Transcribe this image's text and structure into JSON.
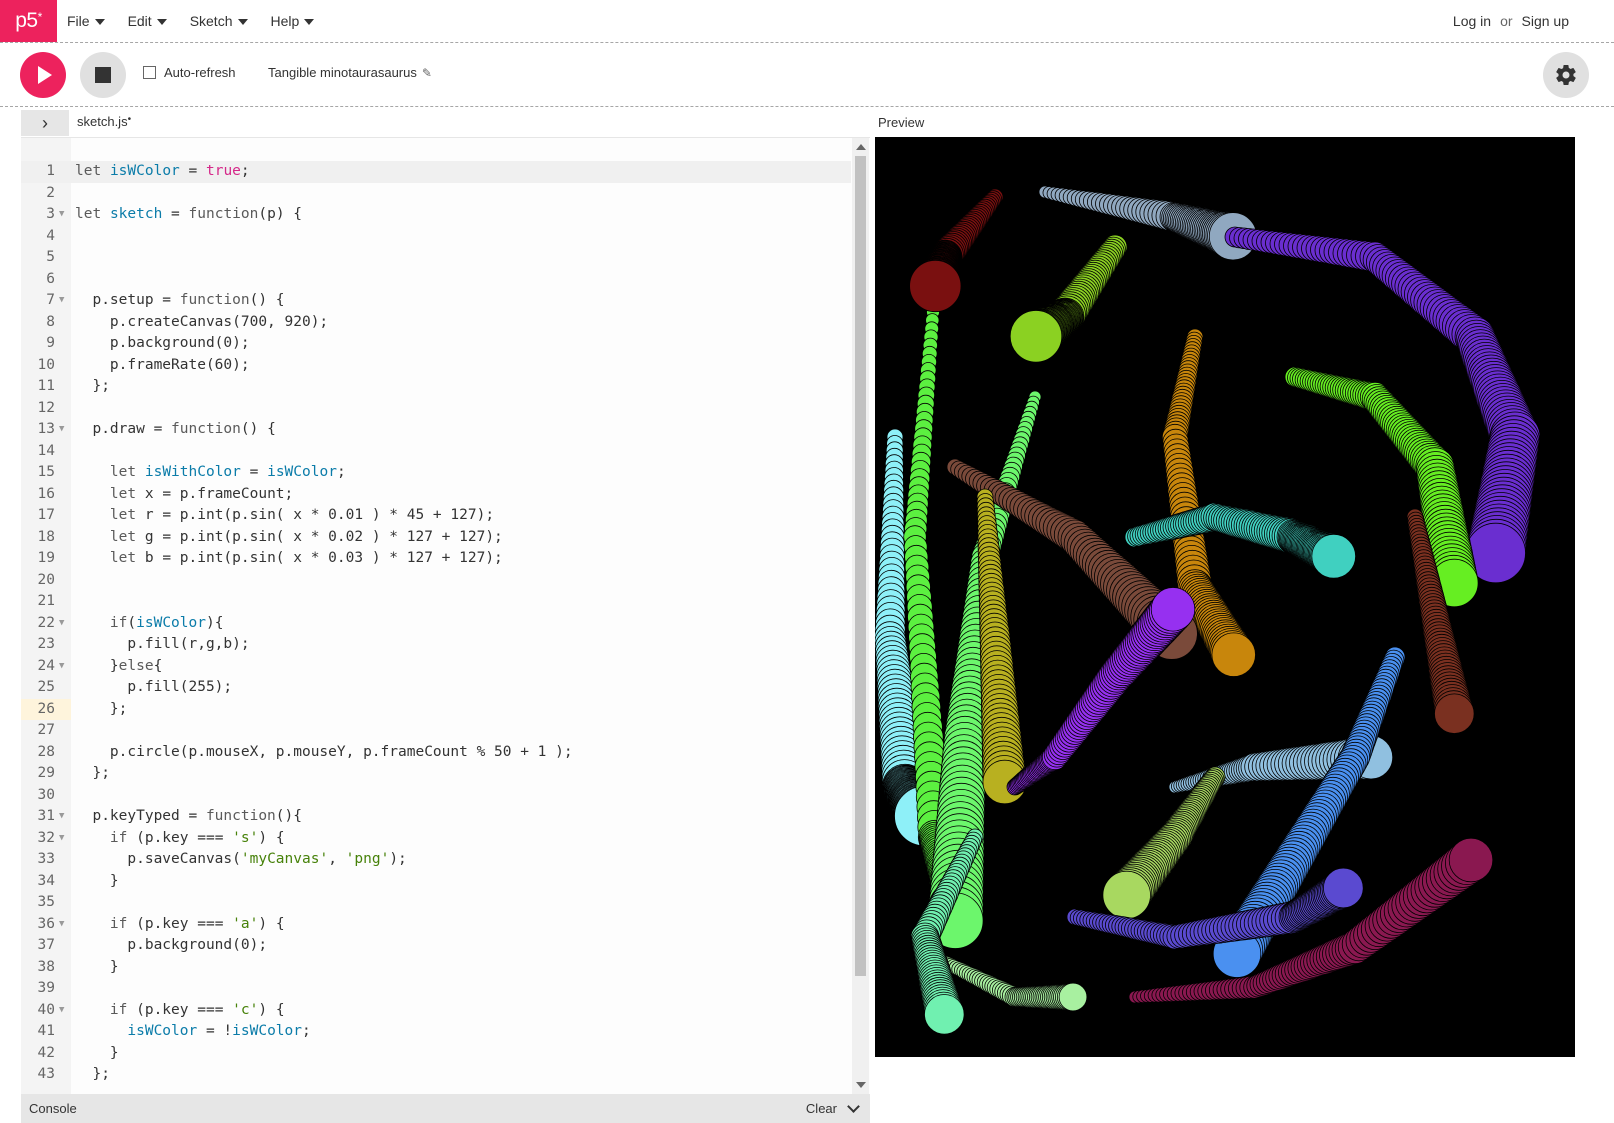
{
  "nav": {
    "logo": "p5",
    "logo_sup": "*",
    "menu": [
      {
        "label": "File"
      },
      {
        "label": "Edit"
      },
      {
        "label": "Sketch"
      },
      {
        "label": "Help"
      }
    ],
    "login": "Log in",
    "or": "or",
    "signup": "Sign up"
  },
  "toolbar": {
    "play_icon": "play-icon",
    "stop_icon": "stop-icon",
    "autorefresh_label": "Auto-refresh",
    "autorefresh_checked": false,
    "sketch_name": "Tangible minotaurasaurus",
    "settings_icon": "gear-icon"
  },
  "editor": {
    "tab_name": "sketch.js",
    "tab_unsaved": "•",
    "current_line": 26,
    "lines": [
      {
        "n": "1",
        "text": "let isWColor = true;",
        "fold": ""
      },
      {
        "n": "2",
        "text": "",
        "fold": ""
      },
      {
        "n": "3",
        "text": "let sketch = function(p) {",
        "fold": "▼"
      },
      {
        "n": "4",
        "text": "",
        "fold": ""
      },
      {
        "n": "5",
        "text": "",
        "fold": ""
      },
      {
        "n": "6",
        "text": "",
        "fold": ""
      },
      {
        "n": "7",
        "text": "  p.setup = function() {",
        "fold": "▼"
      },
      {
        "n": "8",
        "text": "    p.createCanvas(700, 920);",
        "fold": ""
      },
      {
        "n": "9",
        "text": "    p.background(0);",
        "fold": ""
      },
      {
        "n": "10",
        "text": "    p.frameRate(60);",
        "fold": ""
      },
      {
        "n": "11",
        "text": "  };",
        "fold": ""
      },
      {
        "n": "12",
        "text": "",
        "fold": ""
      },
      {
        "n": "13",
        "text": "  p.draw = function() {",
        "fold": "▼"
      },
      {
        "n": "14",
        "text": "",
        "fold": ""
      },
      {
        "n": "15",
        "text": "    let isWithColor = isWColor;",
        "fold": ""
      },
      {
        "n": "16",
        "text": "    let x = p.frameCount;",
        "fold": ""
      },
      {
        "n": "17",
        "text": "    let r = p.int(p.sin( x * 0.01 ) * 45 + 127);",
        "fold": ""
      },
      {
        "n": "18",
        "text": "    let g = p.int(p.sin( x * 0.02 ) * 127 + 127);",
        "fold": ""
      },
      {
        "n": "19",
        "text": "    let b = p.int(p.sin( x * 0.03 ) * 127 + 127);",
        "fold": ""
      },
      {
        "n": "20",
        "text": "",
        "fold": ""
      },
      {
        "n": "21",
        "text": "",
        "fold": ""
      },
      {
        "n": "22",
        "text": "    if(isWColor){",
        "fold": "▼"
      },
      {
        "n": "23",
        "text": "      p.fill(r,g,b);",
        "fold": ""
      },
      {
        "n": "24",
        "text": "    }else{",
        "fold": "▼"
      },
      {
        "n": "25",
        "text": "      p.fill(255);",
        "fold": ""
      },
      {
        "n": "26",
        "text": "    };",
        "fold": ""
      },
      {
        "n": "27",
        "text": "",
        "fold": ""
      },
      {
        "n": "28",
        "text": "    p.circle(p.mouseX, p.mouseY, p.frameCount % 50 + 1 );",
        "fold": ""
      },
      {
        "n": "29",
        "text": "  };",
        "fold": ""
      },
      {
        "n": "30",
        "text": "",
        "fold": ""
      },
      {
        "n": "31",
        "text": "  p.keyTyped = function(){",
        "fold": "▼"
      },
      {
        "n": "32",
        "text": "    if (p.key === 's') {",
        "fold": "▼"
      },
      {
        "n": "33",
        "text": "      p.saveCanvas('myCanvas', 'png');",
        "fold": ""
      },
      {
        "n": "34",
        "text": "    }",
        "fold": ""
      },
      {
        "n": "35",
        "text": "",
        "fold": ""
      },
      {
        "n": "36",
        "text": "    if (p.key === 'a') {",
        "fold": "▼"
      },
      {
        "n": "37",
        "text": "      p.background(0);",
        "fold": ""
      },
      {
        "n": "38",
        "text": "    }",
        "fold": ""
      },
      {
        "n": "39",
        "text": "",
        "fold": ""
      },
      {
        "n": "40",
        "text": "    if (p.key === 'c') {",
        "fold": "▼"
      },
      {
        "n": "41",
        "text": "      isWColor = !isWColor;",
        "fold": ""
      },
      {
        "n": "42",
        "text": "    }",
        "fold": ""
      },
      {
        "n": "43",
        "text": "  };",
        "fold": ""
      }
    ]
  },
  "preview": {
    "label": "Preview",
    "background": "#000000"
  },
  "console": {
    "label": "Console",
    "clear": "Clear"
  },
  "colors": {
    "accent": "#ed225d",
    "button_gray": "#e0e0e0"
  }
}
